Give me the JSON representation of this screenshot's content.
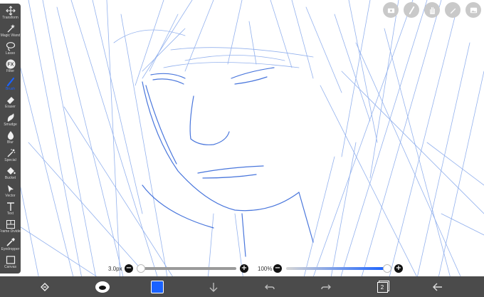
{
  "app": {
    "accent": "#1a62ff",
    "sketch_color": "#3b72e0"
  },
  "tools": [
    {
      "label": "Transform",
      "icon": "move-icon"
    },
    {
      "label": "Magic Wand",
      "icon": "magic-wand-icon"
    },
    {
      "label": "Lasso",
      "icon": "lasso-icon"
    },
    {
      "label": "Filter",
      "icon": "fx-icon"
    },
    {
      "label": "Brush",
      "icon": "brush-icon"
    },
    {
      "label": "Eraser",
      "icon": "eraser-icon"
    },
    {
      "label": "Smudge",
      "icon": "smudge-icon"
    },
    {
      "label": "Blur",
      "icon": "droplet-icon"
    },
    {
      "label": "Special",
      "icon": "special-icon"
    },
    {
      "label": "Bucket",
      "icon": "bucket-icon"
    },
    {
      "label": "Vector",
      "icon": "vector-icon"
    },
    {
      "label": "Text",
      "icon": "text-icon"
    },
    {
      "label": "Frame Divider",
      "icon": "frame-divider-icon"
    },
    {
      "label": "Eyedropper",
      "icon": "eyedropper-icon"
    },
    {
      "label": "Canvas",
      "icon": "canvas-icon"
    }
  ],
  "active_tool": "Brush",
  "brush_size": {
    "label": "3.0px",
    "minus": "−",
    "plus": "+",
    "level": 0.0
  },
  "opacity": {
    "label": "100%",
    "minus": "−",
    "plus": "+",
    "level": 1.0
  },
  "color_swatch": "#1a62ff",
  "layers_count": "2",
  "top_buttons": [
    "layer-settings-icon",
    "brush-preset-icon",
    "hand-icon",
    "pen-icon",
    "image-icon"
  ]
}
